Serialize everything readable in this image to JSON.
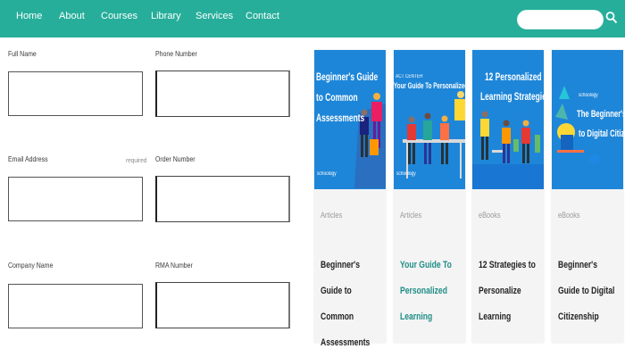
{
  "nav": {
    "items": [
      {
        "label": "Home"
      },
      {
        "label": "About"
      },
      {
        "label": "Courses"
      },
      {
        "label": "Library"
      },
      {
        "label": "Services"
      },
      {
        "label": "Contact"
      }
    ],
    "search_placeholder": "",
    "search_icon": "search-icon"
  },
  "form": {
    "full_name": "Full Name",
    "phone_number": "Phone Number",
    "email_address": "Email Address",
    "required": "required",
    "order_number": "Order Number",
    "company_name": "Company Name",
    "rma_number": "RMA Number"
  },
  "cards": [
    {
      "image_title": [
        "Beginner's Guide",
        "to Common",
        "Assessments"
      ],
      "image_brand": "schoology",
      "tag": "Articles",
      "title": "Beginner's Guide to Common Assessments"
    },
    {
      "image_kicker": "ACT CENTER",
      "image_title": [
        "Your Guide To Personalized Learning"
      ],
      "image_brand": "schoology",
      "tag": "Articles",
      "title": "Your Guide To Personalized Learning"
    },
    {
      "image_title": [
        "12 Personalized",
        "Learning Strategies"
      ],
      "tag": "eBooks",
      "title": "12 Strategies to Personalize Learning"
    },
    {
      "image_brand": "schoology",
      "image_title": [
        "The Beginner's Guide",
        "to Digital Citizenship"
      ],
      "tag": "eBooks",
      "title": "Beginner's Guide to Digital Citizenship"
    }
  ],
  "colors": {
    "nav": "#26ae9b",
    "card_image_blue": "#1e86d8",
    "teal_title": "#1f8d86"
  }
}
